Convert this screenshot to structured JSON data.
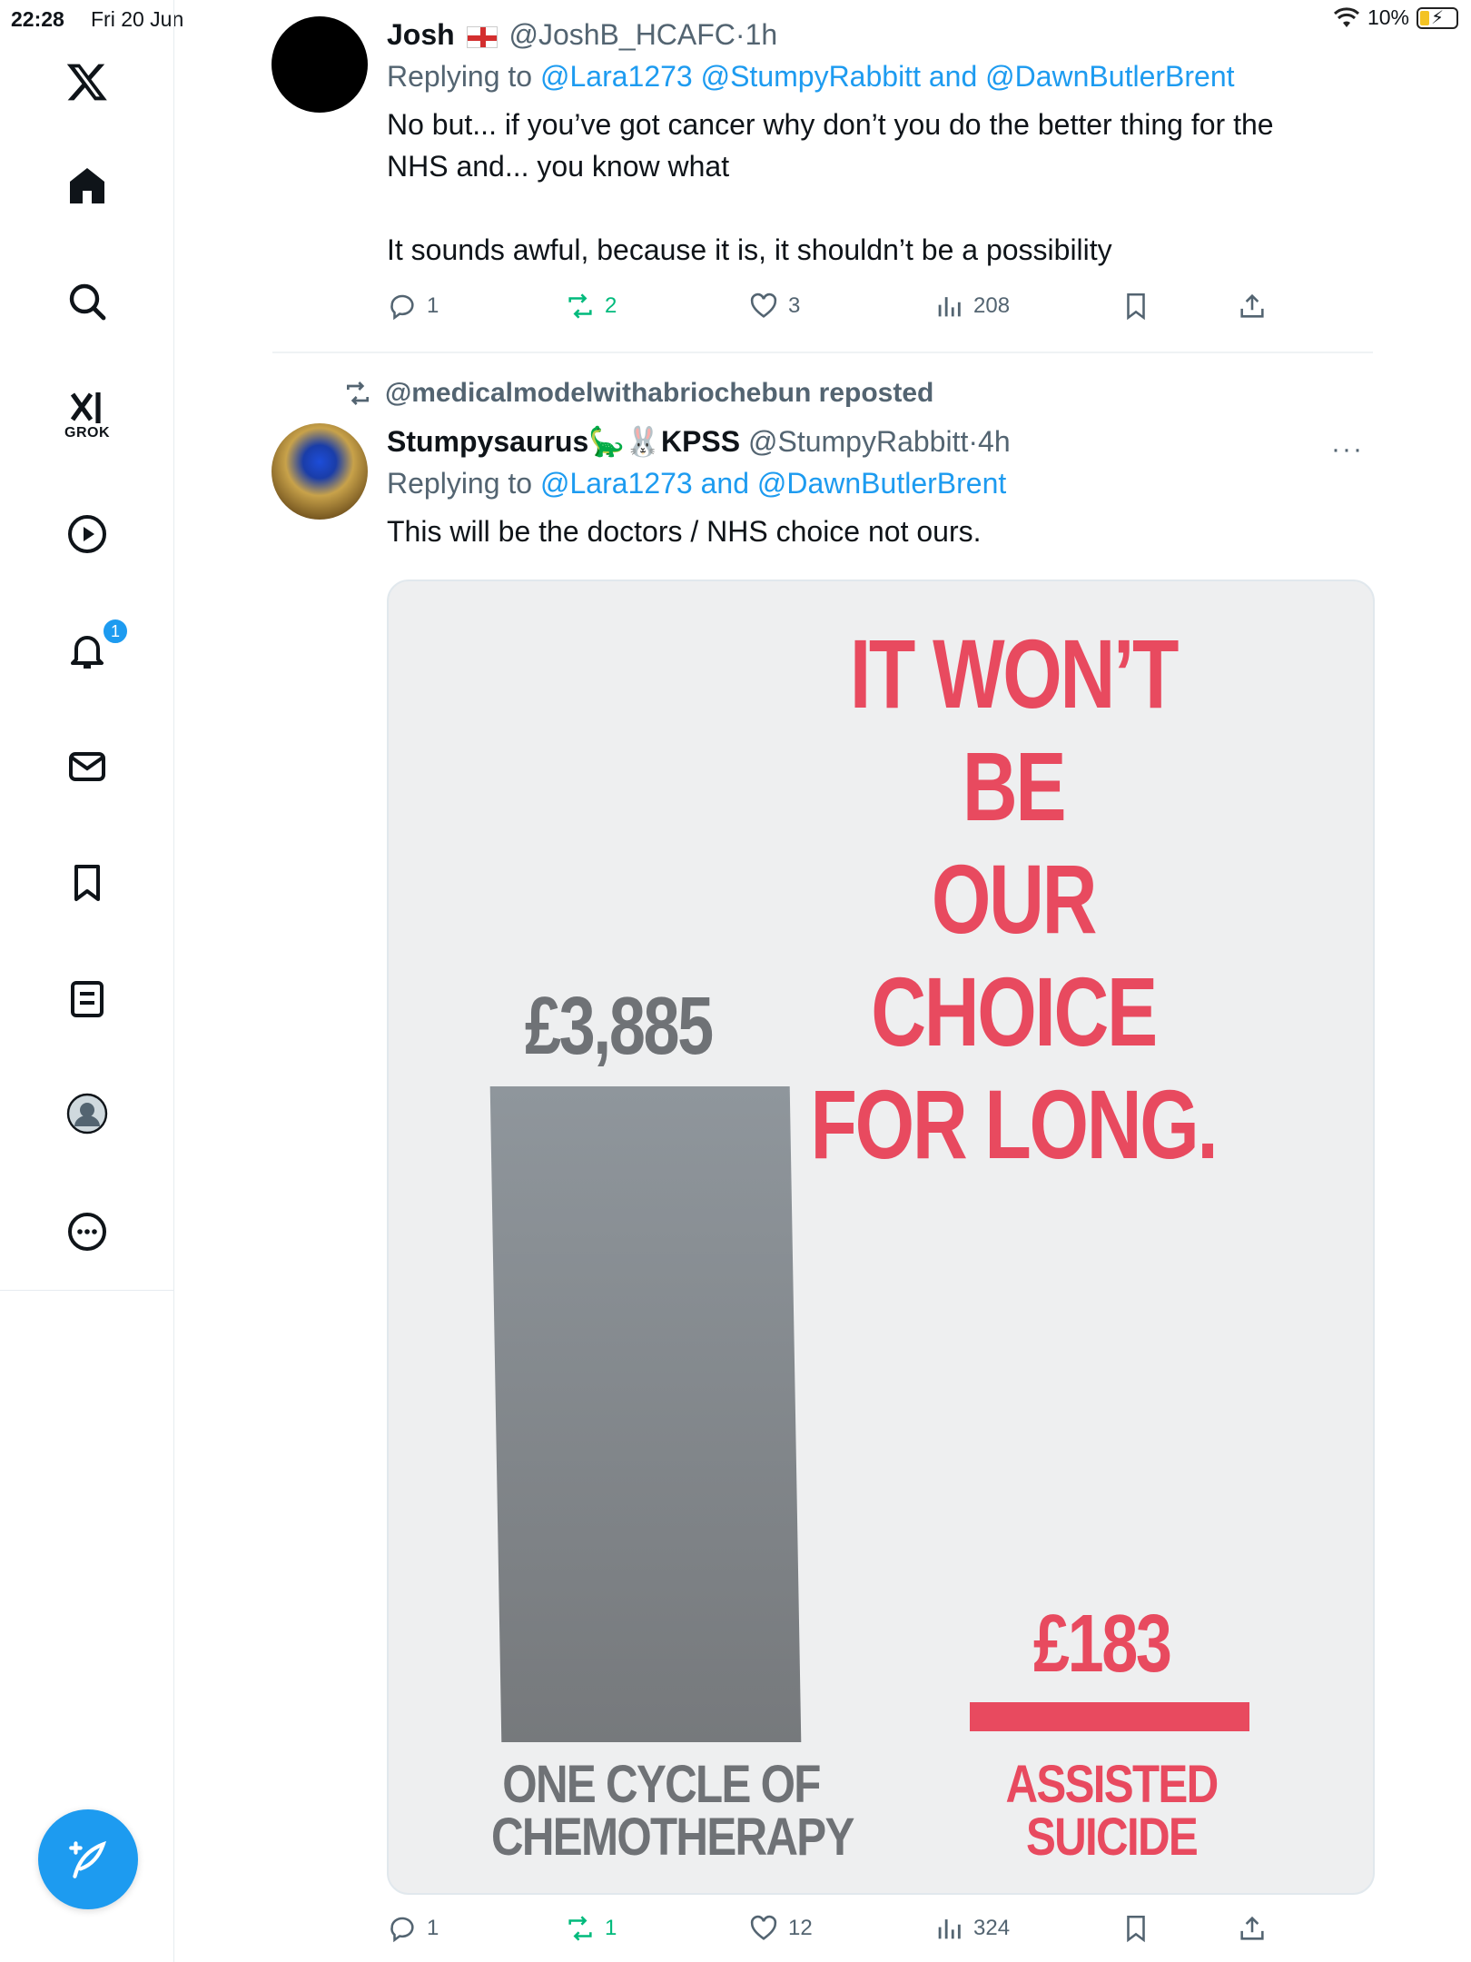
{
  "status_bar": {
    "time": "22:28",
    "date": "Fri 20 Jun",
    "battery": "10%",
    "battery_level": 0.1,
    "icons": [
      "wifi-icon",
      "battery-charging-icon"
    ]
  },
  "sidebar": {
    "grok_label": "GROK",
    "notifications_badge": "1",
    "items": [
      "x-logo",
      "home",
      "search",
      "grok",
      "videos",
      "notifications",
      "messages",
      "bookmarks",
      "lists",
      "profile",
      "more"
    ]
  },
  "tweet1": {
    "name": "Josh",
    "handle": "@JoshB_HCAFC",
    "sep": "·",
    "time": "1h",
    "reply_prefix": "Replying to",
    "reply_targets": "@Lara1273 @StumpyRabbitt and @DawnButlerBrent",
    "text_line1": "No but... if you’ve got cancer why don’t you do the better thing for the",
    "text_line2": "NHS and... you know what",
    "text_line3": "It sounds awful, because it is, it shouldn’t be a possibility",
    "replies": "1",
    "reposts": "2",
    "likes": "3",
    "views": "208"
  },
  "tweet2": {
    "repost_label": "@medicalmodelwithabriochebun reposted",
    "name": "Stumpysaurus🦕🐰KPSS",
    "handle": "@StumpyRabbitt",
    "sep": "·",
    "time": "4h",
    "more": "···",
    "reply_prefix": "Replying to",
    "reply_targets": "@Lara1273 and @DawnButlerBrent",
    "text": "This will be the doctors / NHS choice not ours.",
    "replies": "1",
    "reposts": "1",
    "likes": "12",
    "views": "324"
  },
  "poster": {
    "title_line1": "IT WON’T BE",
    "title_line2": "OUR CHOICE",
    "title_line3": "FOR LONG.",
    "colors": {
      "accent": "#e84a5f",
      "grey": "#6f7276"
    }
  },
  "chart_data": {
    "type": "bar",
    "categories": [
      "ONE CYCLE OF CHEMOTHERAPY",
      "ASSISTED SUICIDE"
    ],
    "category_lines": [
      [
        "ONE CYCLE OF",
        "CHEMOTHERAPY"
      ],
      [
        "ASSISTED",
        "SUICIDE"
      ]
    ],
    "values": [
      3885,
      183
    ],
    "value_labels": [
      "£3,885",
      "£183"
    ],
    "title": "IT WON’T BE OUR CHOICE FOR LONG.",
    "xlabel": "",
    "ylabel": "",
    "ylim": [
      0,
      3885
    ],
    "grid": false
  }
}
